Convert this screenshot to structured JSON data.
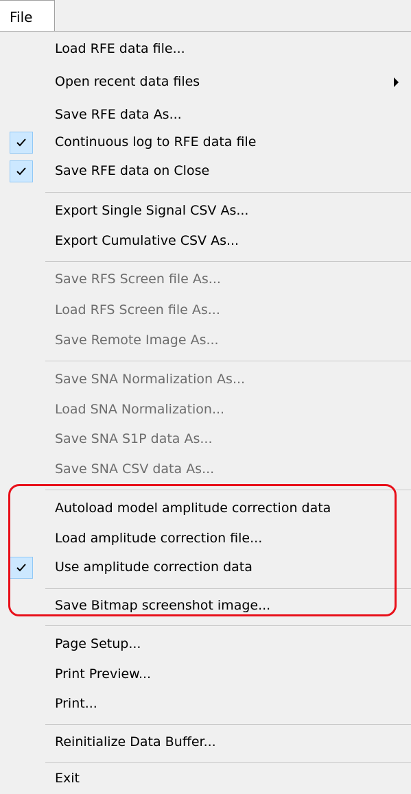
{
  "menubar": {
    "file_label": "File"
  },
  "menu": {
    "items": [
      {
        "label": "Load RFE data file...",
        "enabled": true,
        "checked": false
      },
      {
        "label": "Open recent data files",
        "enabled": true,
        "checked": false,
        "submenu": true
      },
      {
        "label": "Save RFE data As...",
        "enabled": true,
        "checked": false
      },
      {
        "label": "Continuous log to RFE data file",
        "enabled": true,
        "checked": true
      },
      {
        "label": "Save RFE data on Close",
        "enabled": true,
        "checked": true
      },
      {
        "label": "Export Single Signal CSV As...",
        "enabled": true,
        "checked": false
      },
      {
        "label": "Export Cumulative CSV As...",
        "enabled": true,
        "checked": false
      },
      {
        "label": "Save RFS Screen file As...",
        "enabled": false,
        "checked": false
      },
      {
        "label": "Load RFS Screen file As...",
        "enabled": false,
        "checked": false
      },
      {
        "label": "Save Remote Image As...",
        "enabled": false,
        "checked": false
      },
      {
        "label": "Save SNA Normalization As...",
        "enabled": false,
        "checked": false
      },
      {
        "label": "Load SNA Normalization...",
        "enabled": false,
        "checked": false
      },
      {
        "label": "Save SNA S1P data As...",
        "enabled": false,
        "checked": false
      },
      {
        "label": "Save SNA CSV data As...",
        "enabled": false,
        "checked": false
      },
      {
        "label": "Autoload model amplitude correction data",
        "enabled": true,
        "checked": false
      },
      {
        "label": "Load amplitude correction file...",
        "enabled": true,
        "checked": false
      },
      {
        "label": "Use amplitude correction data",
        "enabled": true,
        "checked": true
      },
      {
        "label": "Save Bitmap screenshot image...",
        "enabled": true,
        "checked": false
      },
      {
        "label": "Page Setup...",
        "enabled": true,
        "checked": false
      },
      {
        "label": "Print Preview...",
        "enabled": true,
        "checked": false
      },
      {
        "label": "Print...",
        "enabled": true,
        "checked": false
      },
      {
        "label": "Reinitialize Data Buffer...",
        "enabled": true,
        "checked": false
      },
      {
        "label": "Exit",
        "enabled": true,
        "checked": false
      }
    ]
  },
  "colors": {
    "annotation_outline": "#e8101a",
    "check_background": "#cce8ff",
    "disabled_text": "#6d6d6d"
  }
}
